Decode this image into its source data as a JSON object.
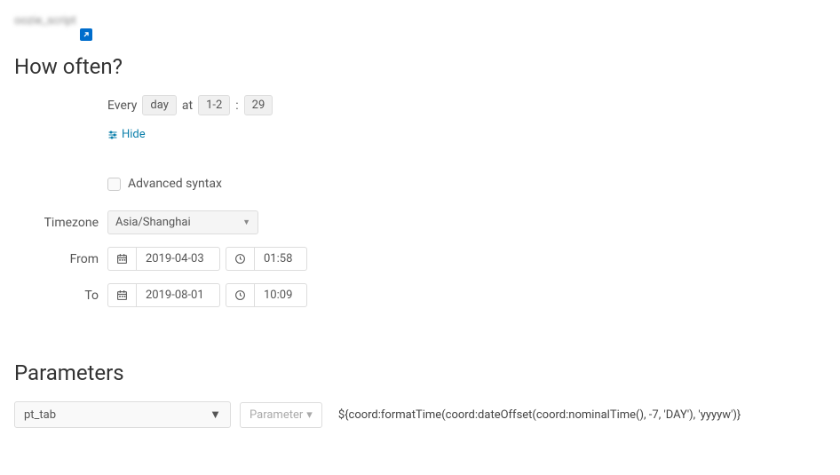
{
  "topLink": {
    "text": "oozie_script"
  },
  "howOften": {
    "heading": "How often?",
    "everyLabel": "Every",
    "unit": "day",
    "atLabel": "at",
    "hours": "1-2",
    "sep": ":",
    "minutes": "29",
    "hideLabel": "Hide",
    "advancedLabel": "Advanced syntax",
    "timezone": {
      "label": "Timezone",
      "value": "Asia/Shanghai"
    },
    "from": {
      "label": "From",
      "date": "2019-04-03",
      "time": "01:58"
    },
    "to": {
      "label": "To",
      "date": "2019-08-01",
      "time": "10:09"
    }
  },
  "parameters": {
    "heading": "Parameters",
    "name": "pt_tab",
    "buttonLabel": "Parameter",
    "value": "${coord:formatTime(coord:dateOffset(coord:nominalTime(), -7, 'DAY'), 'yyyyw')}"
  }
}
